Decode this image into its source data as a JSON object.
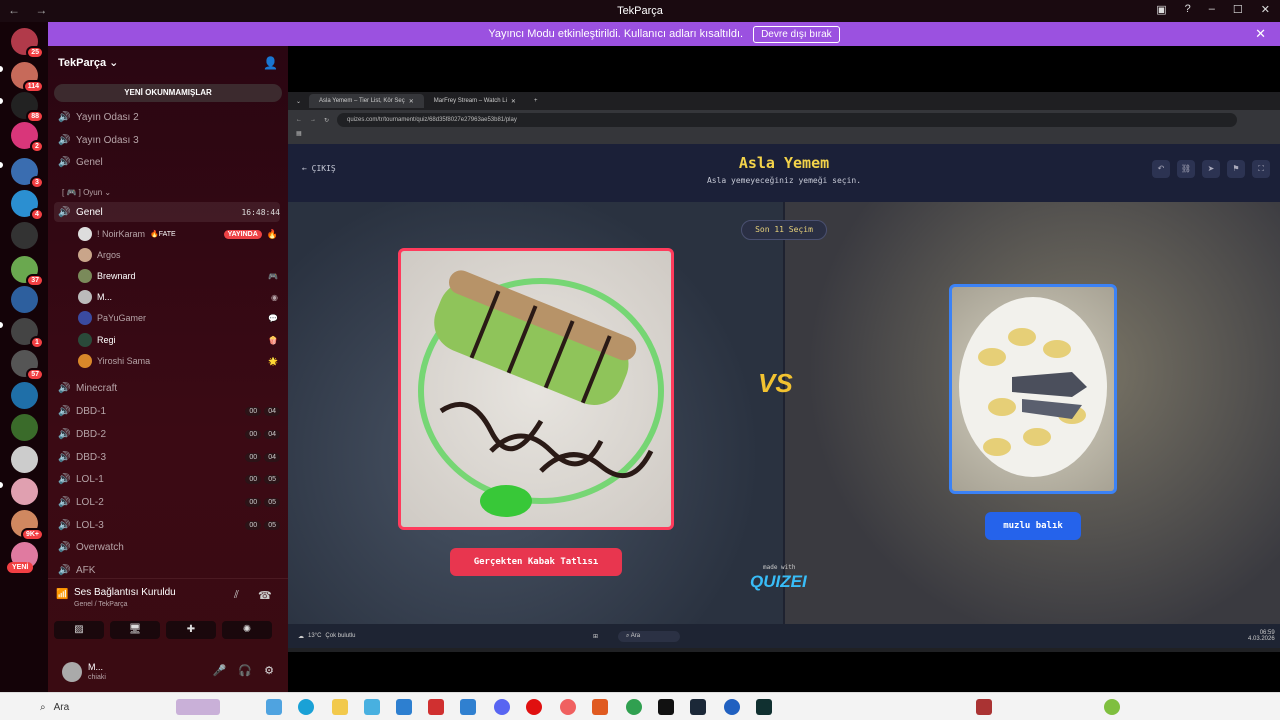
{
  "titlebar": {
    "title": "TekParça",
    "nav": "← →"
  },
  "banner": {
    "message": "Yayıncı Modu etkinleştirildi. Kullanıcı adları kısaltıldı.",
    "button": "Devre dışı bırak"
  },
  "rail": {
    "badges": [
      "25",
      "114",
      "88",
      "2",
      "3",
      "4",
      "37",
      "1",
      "57",
      "9K+"
    ],
    "new_label": "YENİ"
  },
  "sidebar": {
    "server_name": "TekParça",
    "unread_button": "YENİ OKUNMAMIŞLAR",
    "channels_top": [
      "Yayın Odası 2",
      "Yayın Odası 3",
      "Genel"
    ],
    "category": "[ 🎮 ] Oyun",
    "selected_channel": {
      "name": "Genel",
      "time": "16:48:44"
    },
    "users": [
      {
        "name": "! NoirKaram",
        "tag": "🔥FATE",
        "live": "YAYINDA"
      },
      {
        "name": "Argos"
      },
      {
        "name": "Brewnard"
      },
      {
        "name": "M..."
      },
      {
        "name": "PaYuGamer"
      },
      {
        "name": "Regi"
      },
      {
        "name": "Yiroshi Sama"
      }
    ],
    "channels_bottom": [
      {
        "name": "Minecraft",
        "counts": []
      },
      {
        "name": "DBD-1",
        "counts": [
          "00",
          "04"
        ]
      },
      {
        "name": "DBD-2",
        "counts": [
          "00",
          "04"
        ]
      },
      {
        "name": "DBD-3",
        "counts": [
          "00",
          "04"
        ]
      },
      {
        "name": "LOL-1",
        "counts": [
          "00",
          "05"
        ]
      },
      {
        "name": "LOL-2",
        "counts": [
          "00",
          "05"
        ]
      },
      {
        "name": "LOL-3",
        "counts": [
          "00",
          "05"
        ]
      },
      {
        "name": "Overwatch",
        "counts": []
      },
      {
        "name": "AFK",
        "counts": []
      }
    ],
    "voice": {
      "status": "Ses Bağlantısı Kuruldu",
      "location": "Genel / TekParça"
    },
    "me": {
      "name": "M...",
      "status": "chiaki"
    }
  },
  "browser": {
    "tab1": "Asla Yemem – Tier List, Kör Seç",
    "tab2": "MarFrey Stream – Watch Li",
    "url": "quizes.com/tr/tournament/quiz/68d35f8027e27963ae53b81/play"
  },
  "quiz": {
    "back": "ÇIKIŞ",
    "title": "Asla Yemem",
    "subtitle": "Asla yemeyeceğiniz yemeği seçin.",
    "round": "Son 11 Seçim",
    "choice_left": "Gerçekten Kabak Tatlısı",
    "choice_right": "muzlu balık",
    "vs": "VS",
    "made_with": "made with",
    "logo": "QUIZEI"
  },
  "inner_taskbar": {
    "weather_temp": "13°C",
    "weather_desc": "Çok bulutlu",
    "search": "Ara",
    "time": "06:59",
    "date": "4.03.2026"
  },
  "taskbar": {
    "search_placeholder": "Ara"
  },
  "colors": {
    "banner": "#9b51e0",
    "live": "#ed4245",
    "quiz_title": "#f3d34a",
    "left_choice": "#e8364f",
    "right_choice": "#2563eb"
  }
}
